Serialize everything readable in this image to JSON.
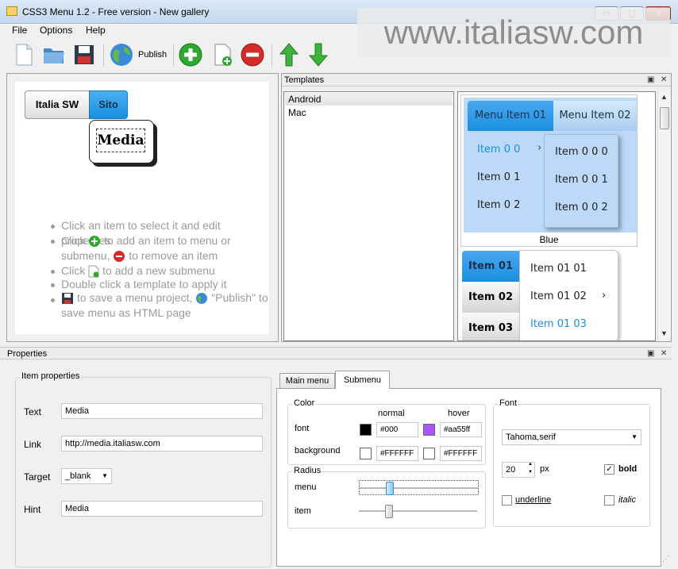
{
  "window": {
    "title": "CSS3 Menu 1.2 - Free version - New gallery",
    "minimize": "▭",
    "maximize": "▢",
    "close": "✕"
  },
  "watermark": "www.italiasw.com",
  "menu": [
    "File",
    "Options",
    "Help"
  ],
  "toolbar": {
    "publish_label": "Publish"
  },
  "preview": {
    "items": [
      "Italia SW",
      "Sito"
    ],
    "submenu_item": "Media",
    "hints": [
      "Click an item to select it and edit properties",
      "Click",
      "to add an item to menu or",
      "submenu,",
      "to remove an item",
      "Click",
      "to add a new submenu",
      "Double click a template to apply it",
      "to save a menu project,",
      "\"Publish\" to",
      "save menu as HTML page"
    ]
  },
  "templates": {
    "title": "Templates",
    "list": [
      "Android",
      "Mac"
    ],
    "selected": "Android",
    "blue": {
      "name": "Blue",
      "top": [
        "Menu Item 01",
        "Menu Item 02"
      ],
      "sub": [
        "Item 0 0",
        "Item 0 1",
        "Item 0 2"
      ],
      "subsub": [
        "Item 0 0 0",
        "Item 0 0 1",
        "Item 0 0 2"
      ],
      "arrow": "›"
    },
    "vertical": {
      "left": [
        "Item 01",
        "Item 02",
        "Item 03"
      ],
      "right": [
        "Item 01 01",
        "Item 01 02",
        "Item 01 03"
      ],
      "arrow": "›"
    }
  },
  "properties": {
    "title": "Properties",
    "item_group": "Item properties",
    "text_label": "Text",
    "text_value": "Media",
    "link_label": "Link",
    "link_value": "http://media.italiasw.com",
    "target_label": "Target",
    "target_value": "_blank",
    "hint_label": "Hint",
    "hint_value": "Media",
    "tabs": [
      "Main menu",
      "Submenu"
    ],
    "active_tab": "Submenu",
    "color_group": "Color",
    "normal": "normal",
    "hover": "hover",
    "font_label": "font",
    "font_normal": "#000",
    "font_hover": "#aa55ff",
    "bg_label": "background",
    "bg_normal": "#FFFFFF",
    "bg_hover": "#FFFFFF",
    "radius_group": "Radius",
    "menu_label": "menu",
    "item_label": "item",
    "font_group": "Font",
    "font_family": "Tahoma,serif",
    "font_size": "20",
    "px": "px",
    "bold": "bold",
    "underline": "underline",
    "italic": "italic"
  },
  "colors": {
    "accent": "#1a8fe0",
    "blue_bg": "#bcdaf8",
    "purple": "#aa55ff"
  }
}
